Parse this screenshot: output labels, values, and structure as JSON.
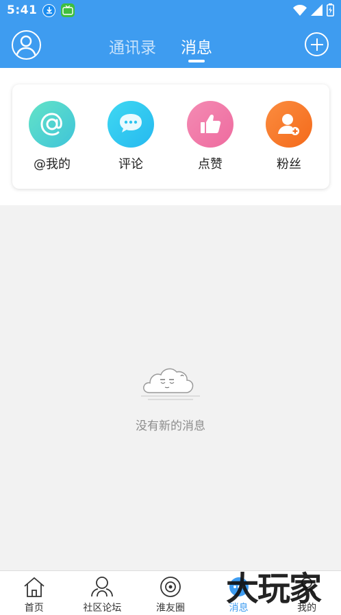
{
  "status_bar": {
    "time": "5:41",
    "icons": [
      "download-icon",
      "tv-app-icon",
      "wifi-icon",
      "cell-signal-icon",
      "battery-icon"
    ]
  },
  "header": {
    "tabs": [
      {
        "label": "通讯录",
        "active": false
      },
      {
        "label": "消息",
        "active": true
      }
    ],
    "left_icon": "user-avatar-icon",
    "right_icon": "plus-circle-icon"
  },
  "categories": [
    {
      "label": "@我的",
      "icon": "at-icon",
      "color": "#4fd0cf"
    },
    {
      "label": "评论",
      "icon": "chat-bubble-icon",
      "color": "#2ec5f0"
    },
    {
      "label": "点赞",
      "icon": "thumbs-up-icon",
      "color": "#f07aa8"
    },
    {
      "label": "粉丝",
      "icon": "add-user-icon",
      "color": "#f77a2a"
    }
  ],
  "empty_state": {
    "text": "没有新的消息",
    "icon": "sleepy-cloud-icon"
  },
  "bottom_nav": [
    {
      "label": "首页",
      "icon": "home-icon",
      "active": false
    },
    {
      "label": "社区论坛",
      "icon": "community-icon",
      "active": false
    },
    {
      "label": "淮友圈",
      "icon": "moments-icon",
      "active": false
    },
    {
      "label": "消息",
      "icon": "message-icon",
      "active": true
    },
    {
      "label": "我的",
      "icon": "profile-icon",
      "active": false
    }
  ],
  "watermark": "大玩家",
  "colors": {
    "primary": "#3e9cf0",
    "background": "#f2f2f2"
  }
}
